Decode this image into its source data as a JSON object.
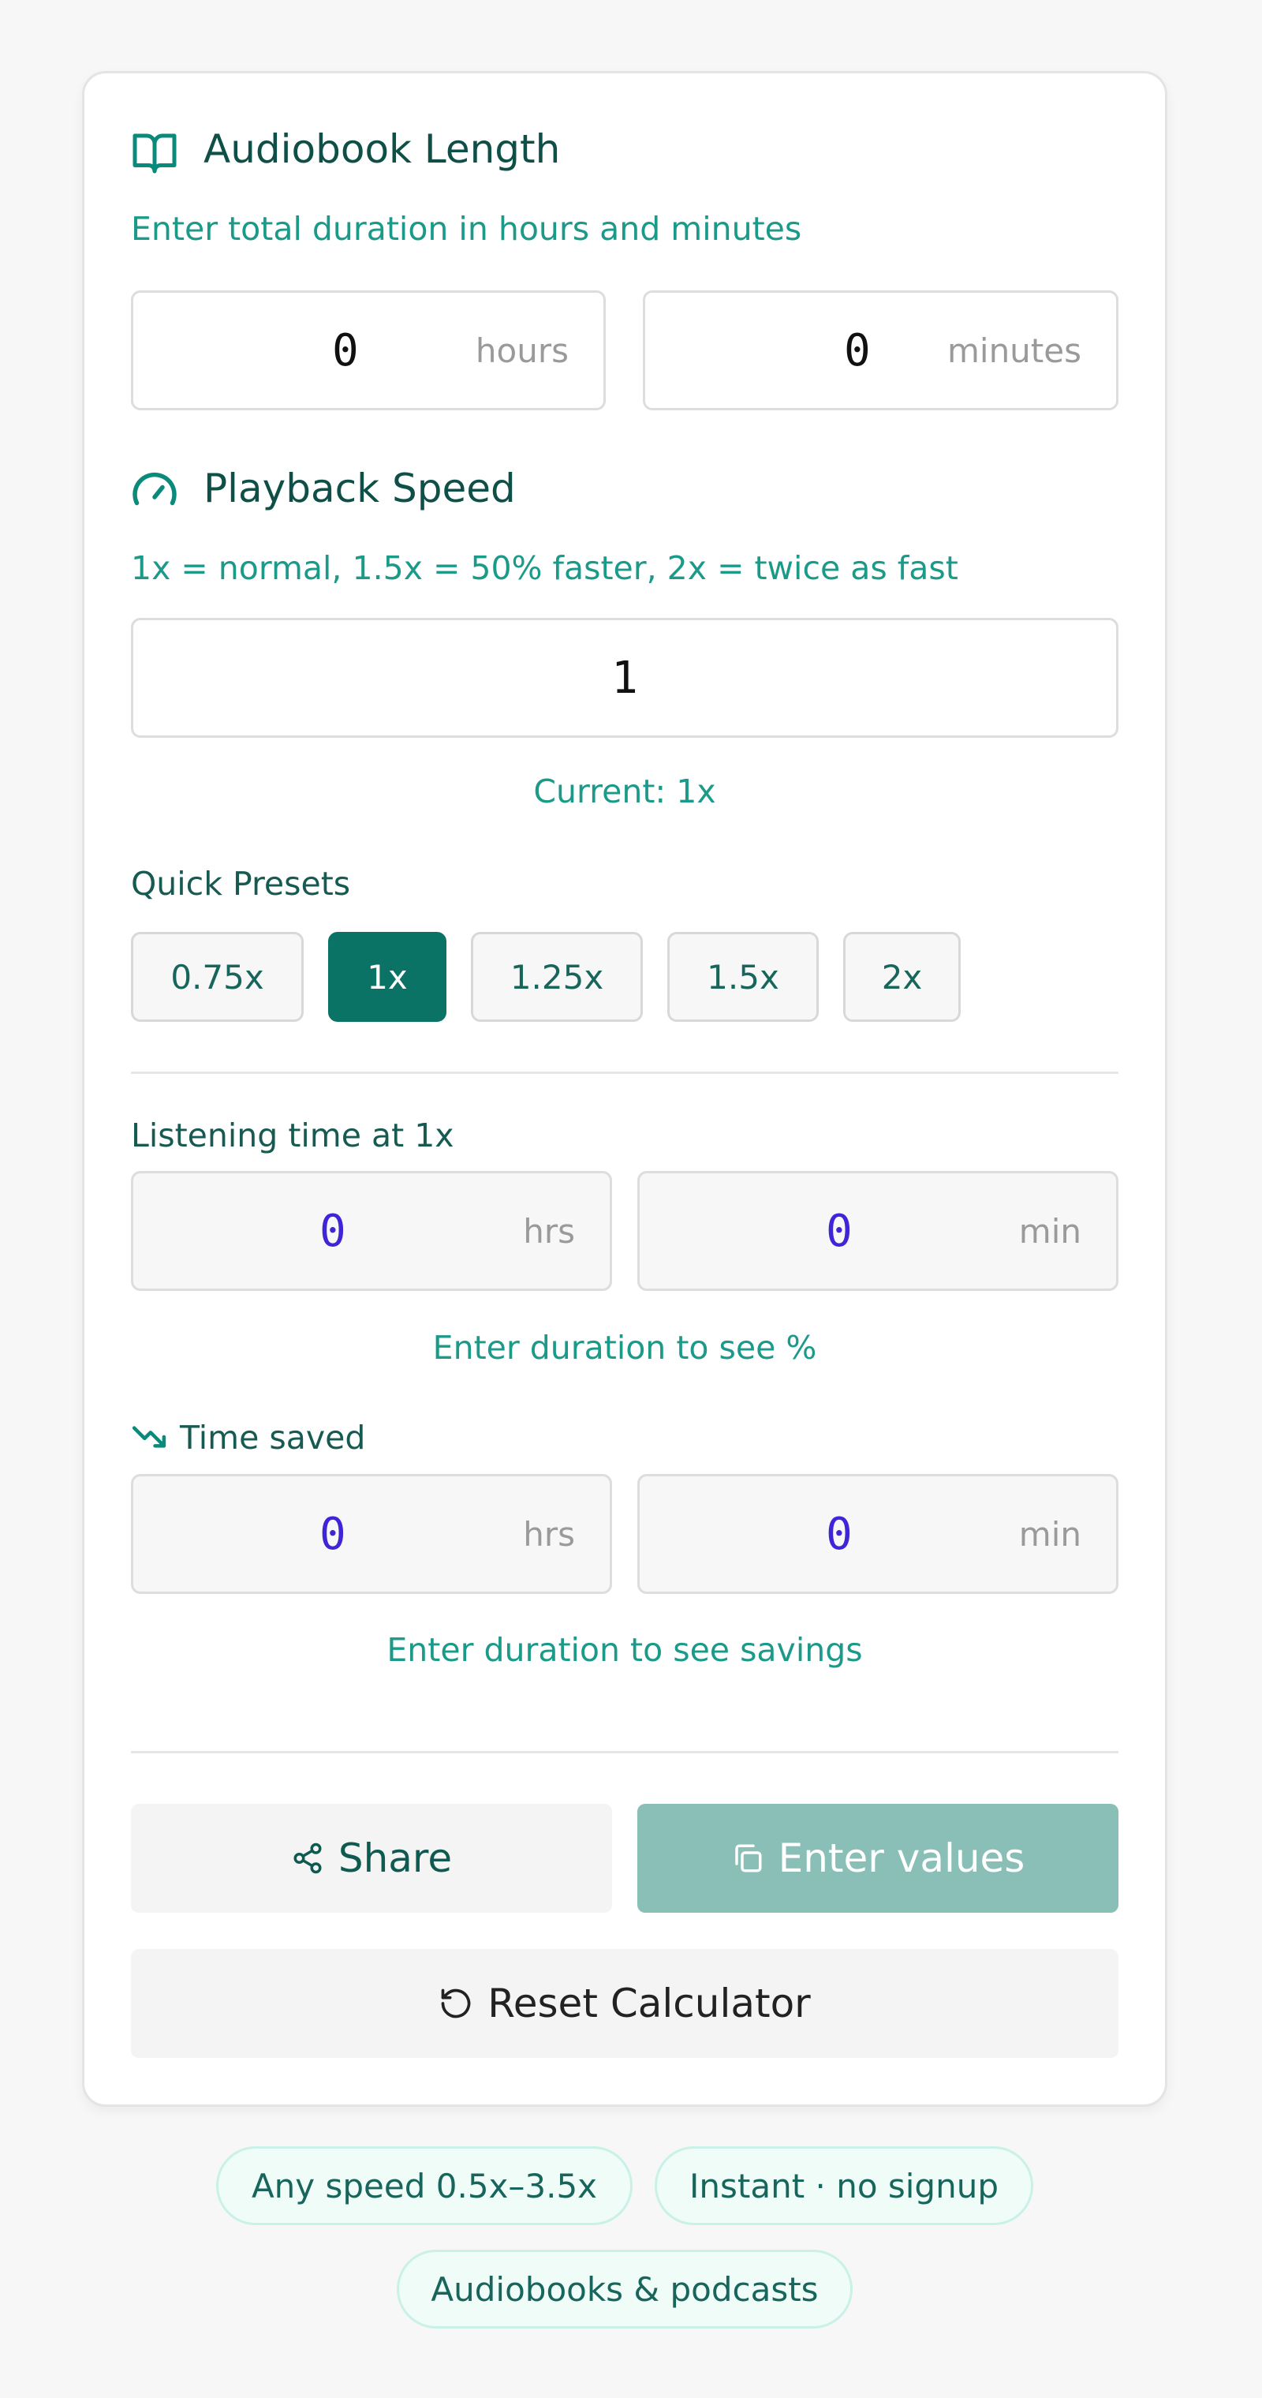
{
  "length": {
    "title": "Audiobook Length",
    "hint": "Enter total duration in hours and minutes",
    "hours_value": "0",
    "hours_unit": "hours",
    "minutes_value": "0",
    "minutes_unit": "minutes"
  },
  "speed": {
    "title": "Playback Speed",
    "hint": "1x = normal, 1.5x = 50% faster, 2x = twice as fast",
    "value": "1",
    "current": "Current: 1x"
  },
  "presets": {
    "label": "Quick Presets",
    "items": [
      "0.75x",
      "1x",
      "1.25x",
      "1.5x",
      "2x"
    ],
    "active": "1x"
  },
  "listening": {
    "label": "Listening time at 1x",
    "hrs_value": "0",
    "hrs_unit": "hrs",
    "min_value": "0",
    "min_unit": "min",
    "note": "Enter duration to see %"
  },
  "saved": {
    "label": "Time saved",
    "hrs_value": "0",
    "hrs_unit": "hrs",
    "min_value": "0",
    "min_unit": "min",
    "note": "Enter duration to see savings"
  },
  "actions": {
    "share_label": "Share",
    "copy_label": "Enter values",
    "reset_label": "Reset Calculator"
  },
  "badges": [
    "Any speed 0.5x–3.5x",
    "Instant · no signup",
    "Audiobooks & podcasts"
  ],
  "colors": {
    "accent": "#0a7366",
    "accent_text": "#1b9a8a",
    "result_number": "#3f25d8",
    "disabled_button": "#89bfb6"
  },
  "icons": {
    "length": "book-open-icon",
    "speed": "gauge-icon",
    "saved": "trending-down-icon",
    "share": "share-icon",
    "copy": "copy-icon",
    "reset": "rotate-ccw-icon"
  }
}
